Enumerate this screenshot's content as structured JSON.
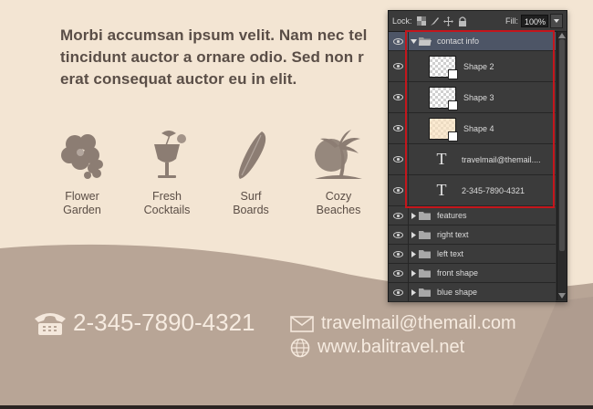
{
  "headline": {
    "line1": "Morbi accumsan ipsum velit. Nam nec tel",
    "line2": "tincidunt auctor a ornare odio. Sed non  r",
    "line3": "erat consequat auctor eu in elit."
  },
  "features": [
    {
      "icon": "hibiscus-flower-icon",
      "line1": "Flower",
      "line2": "Garden"
    },
    {
      "icon": "cocktail-glass-icon",
      "line1": "Fresh",
      "line2": "Cocktails"
    },
    {
      "icon": "surfboard-icon",
      "line1": "Surf",
      "line2": "Boards"
    },
    {
      "icon": "palm-trees-icon",
      "line1": "Cozy",
      "line2": "Beaches"
    }
  ],
  "contact": {
    "phone": "2-345-7890-4321",
    "email": "travelmail@themail.com",
    "website": "www.balitravel.net"
  },
  "layers_panel": {
    "lock_label": "Lock:",
    "fill_label": "Fill:",
    "fill_value": "100%",
    "group_open": {
      "name": "contact info"
    },
    "children": [
      {
        "type": "shape",
        "name": "Shape 2"
      },
      {
        "type": "shape",
        "name": "Shape 3"
      },
      {
        "type": "shape",
        "name": "Shape 4"
      },
      {
        "type": "text",
        "name": "travelmail@themail...."
      },
      {
        "type": "text",
        "name": "2-345-7890-4321"
      }
    ],
    "groups": [
      {
        "name": "features"
      },
      {
        "name": "right text"
      },
      {
        "name": "left text"
      },
      {
        "name": "front shape"
      },
      {
        "name": "blue shape"
      }
    ]
  },
  "colors": {
    "cream_bg": "#f3e5d3",
    "taupe_bg": "#b9a596",
    "highlight_red": "#c4161c",
    "panel_dark": "#323232"
  }
}
